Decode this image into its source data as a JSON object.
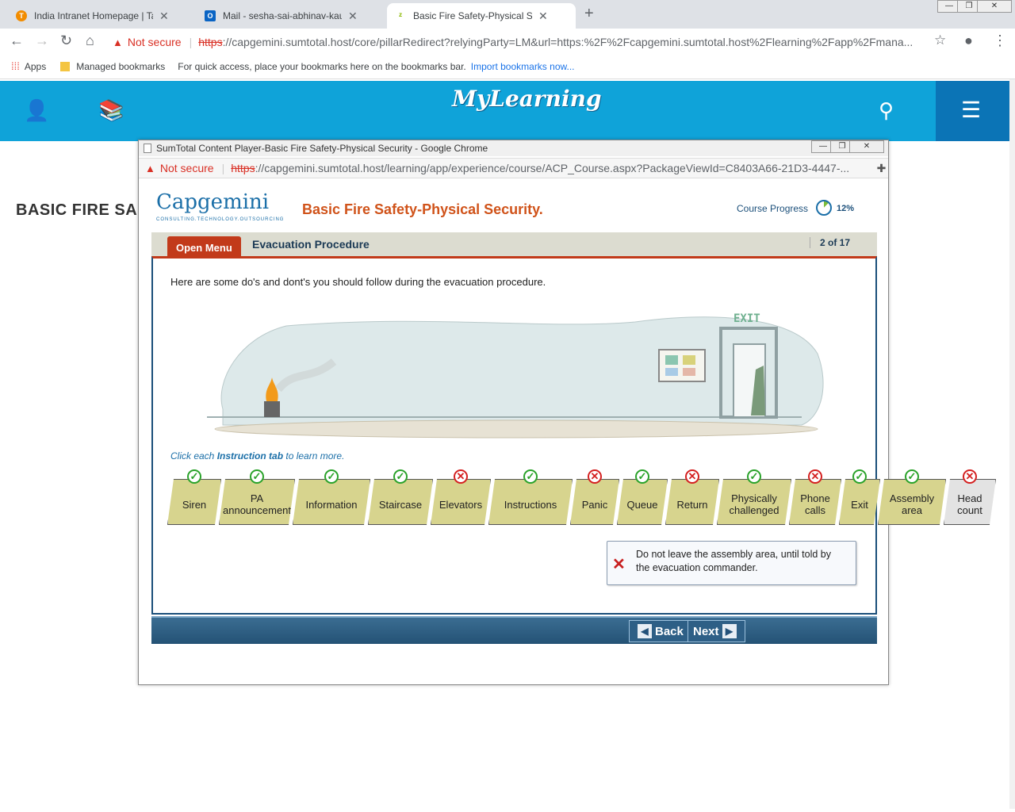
{
  "browser": {
    "tabs": [
      {
        "title": "India Intranet Homepage | Talent"
      },
      {
        "title": "Mail - sesha-sai-abhinav-kaushal"
      },
      {
        "title": "Basic Fire Safety-Physical Security"
      }
    ],
    "not_secure": "Not secure",
    "url_scheme": "https",
    "url_rest": "://capgemini.sumtotal.host/core/pillarRedirect?relyingParty=LM&url=https:%2F%2Fcapgemini.sumtotal.host%2Flearning%2Fapp%2Fmana...",
    "bookmarks": {
      "apps": "Apps",
      "managed": "Managed bookmarks",
      "hint": "For quick access, place your bookmarks here on the bookmarks bar.",
      "import": "Import bookmarks now..."
    }
  },
  "site": {
    "logo": "MyLearning",
    "page_title": "BASIC FIRE SAI"
  },
  "popup": {
    "window_title": "SumTotal Content Player-Basic Fire Safety-Physical Security - Google Chrome",
    "not_secure": "Not secure",
    "url_scheme": "https",
    "url_rest": "://capgemini.sumtotal.host/learning/app/experience/course/ACP_Course.aspx?PackageViewId=C8403A66-21D3-4447-...",
    "brand": "Capgemini",
    "brand_tagline": "CONSULTING.TECHNOLOGY.OUTSOURCING",
    "course_title": "Basic Fire Safety-Physical Security.",
    "course_progress_label": "Course Progress",
    "course_progress_value": "12%",
    "open_menu": "Open Menu",
    "lesson_title": "Evacuation Procedure",
    "page_counter": "2 of 17",
    "intro": "Here are some do's and dont's you should follow during the evacuation procedure.",
    "click_prefix": "Click each ",
    "click_bold": "Instruction tab",
    "click_suffix": " to learn more.",
    "exit_sign": "EXIT",
    "instruction_tabs": [
      {
        "label": "Siren",
        "status": "do"
      },
      {
        "label": "PA announcement",
        "status": "do"
      },
      {
        "label": "Information",
        "status": "do"
      },
      {
        "label": "Staircase",
        "status": "do"
      },
      {
        "label": "Elevators",
        "status": "dont"
      },
      {
        "label": "Instructions",
        "status": "do"
      },
      {
        "label": "Panic",
        "status": "dont"
      },
      {
        "label": "Queue",
        "status": "do"
      },
      {
        "label": "Return",
        "status": "dont"
      },
      {
        "label": "Physically challenged",
        "status": "do"
      },
      {
        "label": "Phone calls",
        "status": "dont"
      },
      {
        "label": "Exit",
        "status": "do"
      },
      {
        "label": "Assembly area",
        "status": "do"
      },
      {
        "label": "Head count",
        "status": "dont"
      }
    ],
    "tooltip": "Do not leave the assembly area, until told by the evacuation commander.",
    "back": "Back",
    "next": "Next"
  },
  "colors": {
    "site_bar": "#0fa3d9",
    "accent": "#c23a1a",
    "tab_fill": "#d7d48e"
  }
}
